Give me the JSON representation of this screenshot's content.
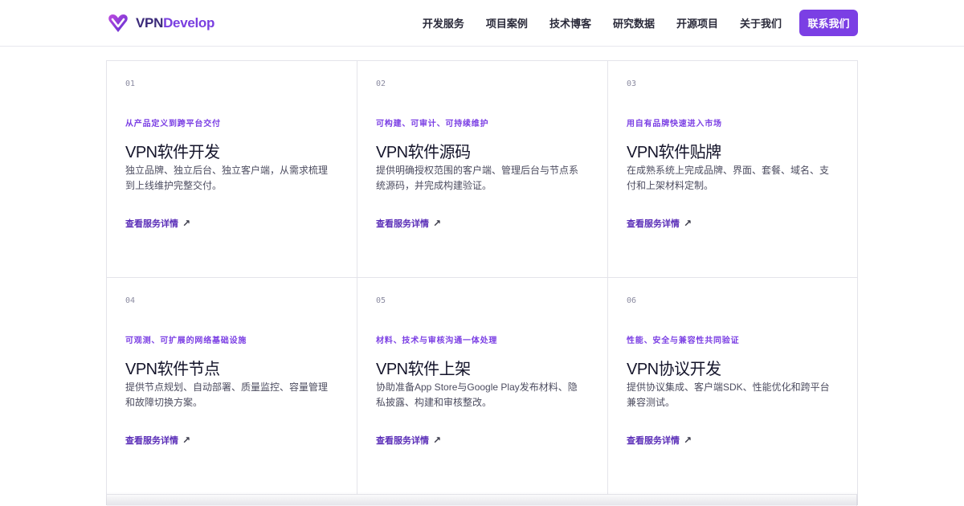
{
  "brand": {
    "name_part1": "VPN",
    "name_part2": "Develop",
    "logo_icon": "heart-v-logo-icon",
    "accent_color": "#7b3fe4"
  },
  "nav": {
    "items": [
      "开发服务",
      "项目案例",
      "技术博客",
      "研究数据",
      "开源项目",
      "关于我们"
    ],
    "cta_label": "联系我们"
  },
  "services": [
    {
      "num": "01",
      "tag": "从产品定义到跨平台交付",
      "title": "VPN软件开发",
      "desc": "独立品牌、独立后台、独立客户端，从需求梳理到上线维护完整交付。",
      "link": "查看服务详情"
    },
    {
      "num": "02",
      "tag": "可构建、可审计、可持续维护",
      "title": "VPN软件源码",
      "desc": "提供明确授权范围的客户端、管理后台与节点系统源码，并完成构建验证。",
      "link": "查看服务详情"
    },
    {
      "num": "03",
      "tag": "用自有品牌快速进入市场",
      "title": "VPN软件贴牌",
      "desc": "在成熟系统上完成品牌、界面、套餐、域名、支付和上架材料定制。",
      "link": "查看服务详情"
    },
    {
      "num": "04",
      "tag": "可观测、可扩展的网络基础设施",
      "title": "VPN软件节点",
      "desc": "提供节点规划、自动部署、质量监控、容量管理和故障切换方案。",
      "link": "查看服务详情"
    },
    {
      "num": "05",
      "tag": "材料、技术与审核沟通一体处理",
      "title": "VPN软件上架",
      "desc": "协助准备App Store与Google Play发布材料、隐私披露、构建和审核整改。",
      "link": "查看服务详情"
    },
    {
      "num": "06",
      "tag": "性能、安全与兼容性共同验证",
      "title": "VPN协议开发",
      "desc": "提供协议集成、客户端SDK、性能优化和跨平台兼容测试。",
      "link": "查看服务详情"
    }
  ],
  "link_arrow": "↗"
}
